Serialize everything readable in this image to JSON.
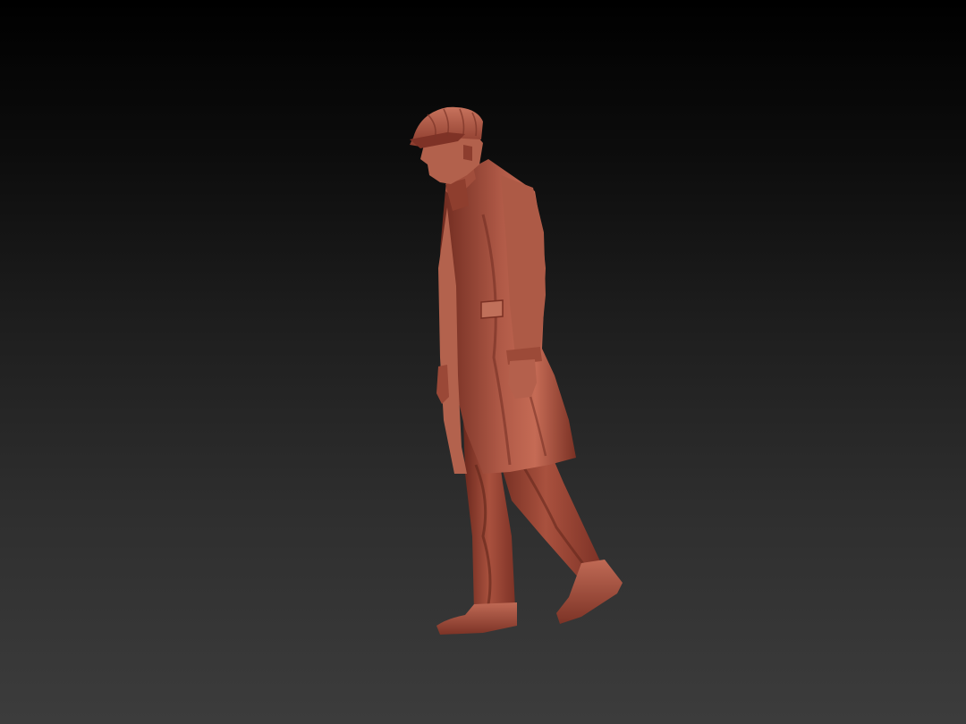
{
  "viewport": {
    "background_top": "#000000",
    "background_bottom": "#3c3c3c"
  },
  "model": {
    "material_color": "#a8503f",
    "shadow_color": "#5a2219",
    "highlight_color": "#d07a64",
    "icon": "sculpted-figure"
  }
}
